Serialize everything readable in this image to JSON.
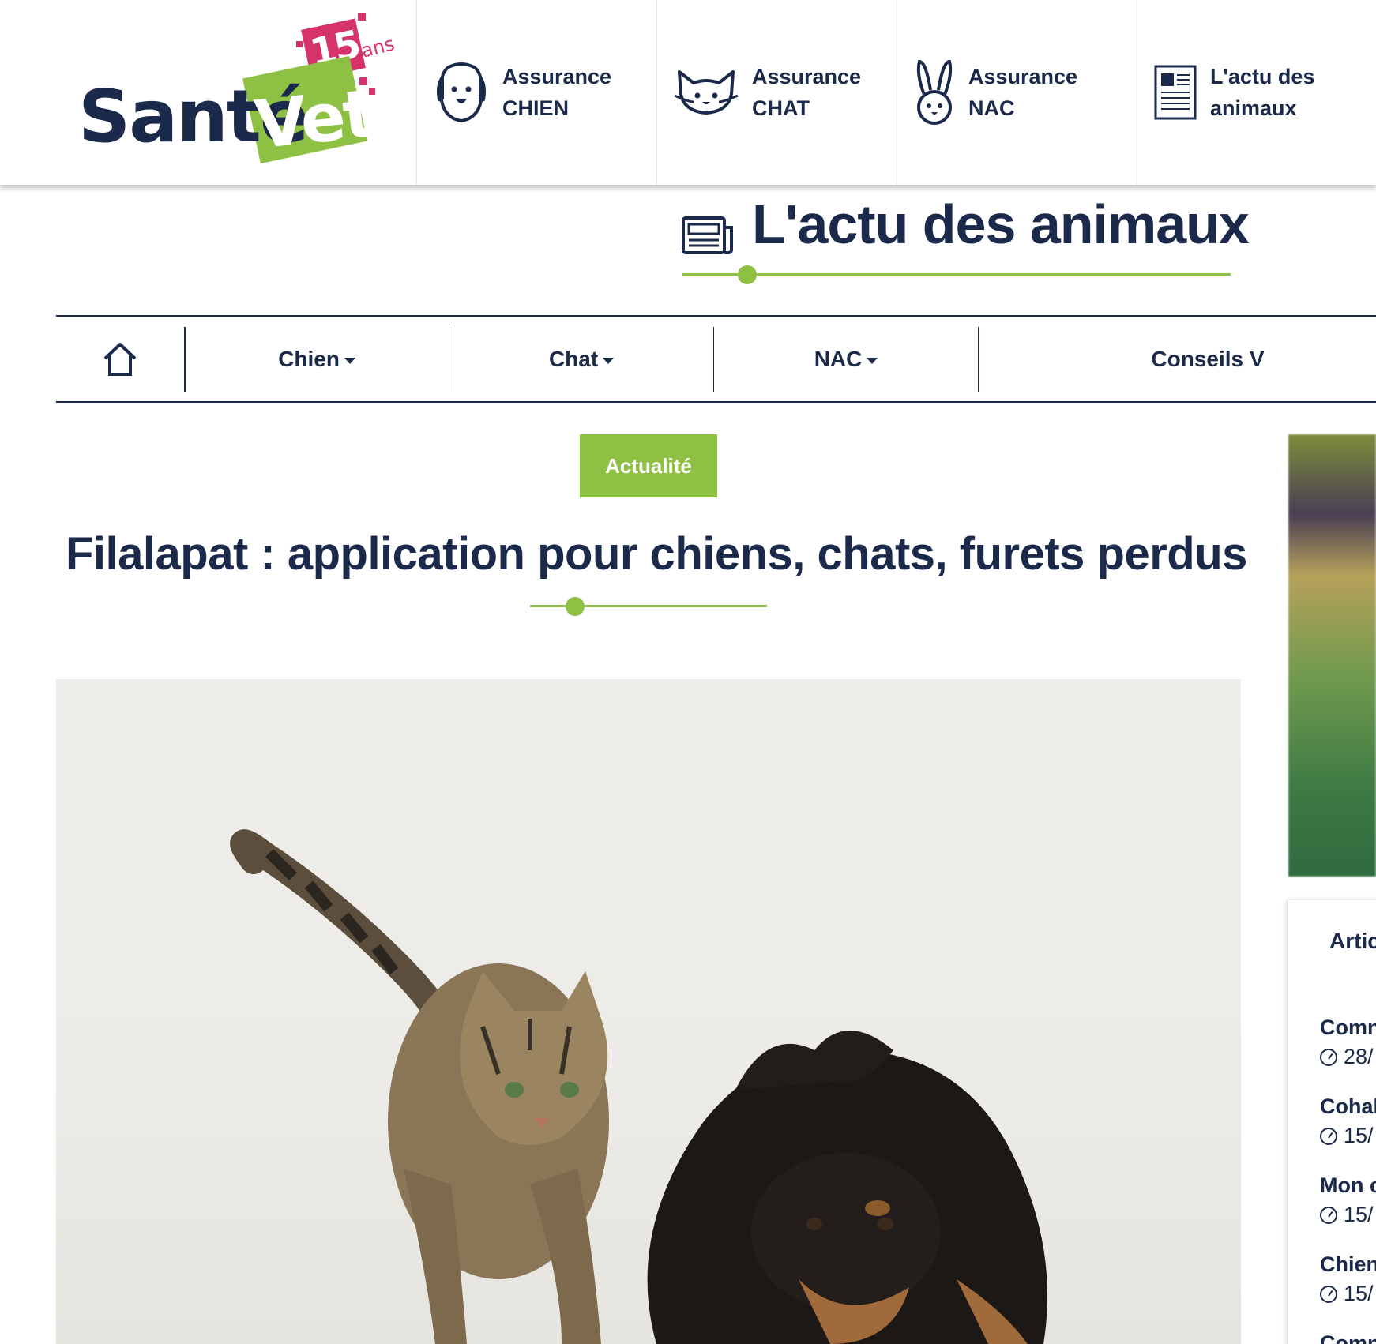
{
  "header": {
    "logo": {
      "brand_text_dark": "Santé",
      "brand_text_box": "Vet",
      "anniversary_number": "15",
      "anniversary_suffix": "ans"
    },
    "nav": [
      {
        "line1": "Assurance",
        "line2": "CHIEN",
        "icon": "dog-icon"
      },
      {
        "line1": "Assurance",
        "line2": "CHAT",
        "icon": "cat-icon"
      },
      {
        "line1": "Assurance",
        "line2": "NAC",
        "icon": "rabbit-icon"
      },
      {
        "line1": "L'actu des",
        "line2": "animaux",
        "icon": "newspaper-icon"
      }
    ]
  },
  "section": {
    "title": "L'actu des animaux",
    "icon": "newspaper-icon"
  },
  "categories": {
    "home_icon": "home-icon",
    "items": [
      {
        "label": "Chien"
      },
      {
        "label": "Chat"
      },
      {
        "label": "NAC"
      },
      {
        "label": "Conseils V"
      }
    ]
  },
  "article": {
    "tag": "Actualité",
    "title": "Filalapat : application pour chiens, chats, furets perdus",
    "image_alt": "chat tigré et chien noir"
  },
  "sidebar": {
    "heading": "Artic",
    "items": [
      {
        "title": "Comn",
        "date": "28/"
      },
      {
        "title": "Cohab",
        "date": "15/"
      },
      {
        "title": "Mon c",
        "date": "15/"
      },
      {
        "title": "Chien",
        "date": "15/"
      },
      {
        "title": "Comn",
        "date": ""
      }
    ]
  },
  "colors": {
    "navy": "#1b2a4a",
    "green": "#8dc043",
    "pink": "#d6336c"
  }
}
